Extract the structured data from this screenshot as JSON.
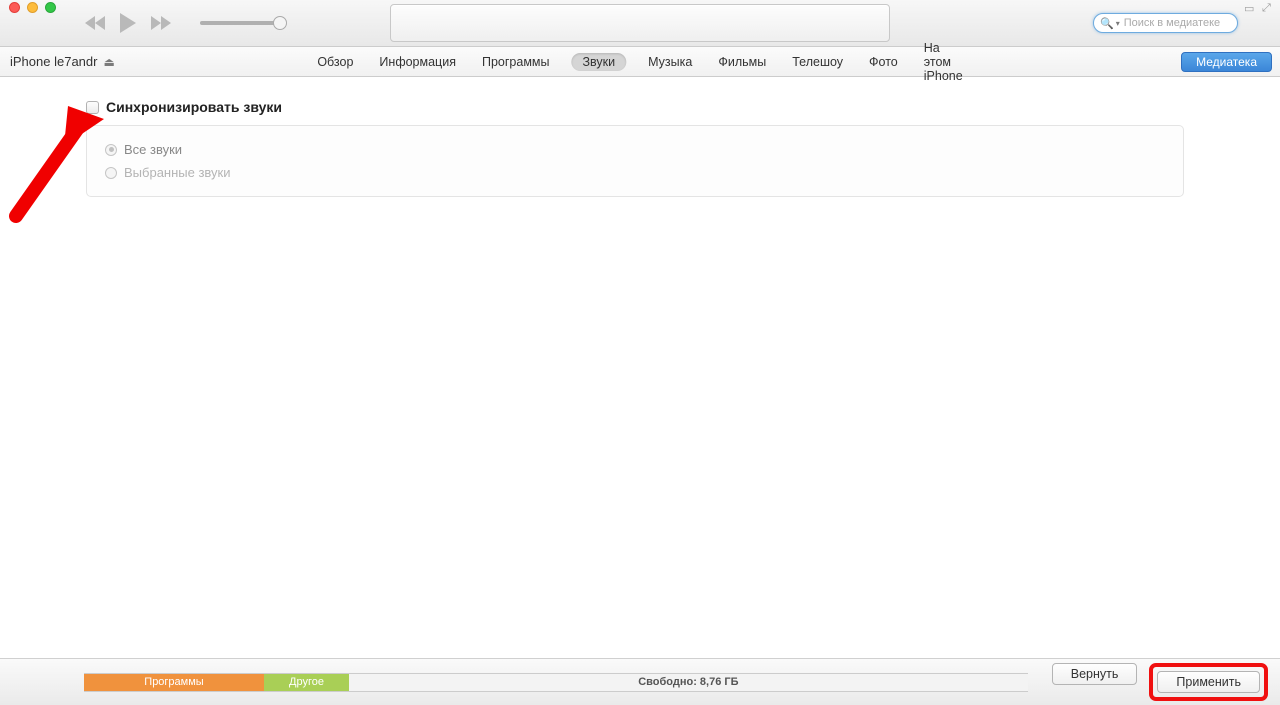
{
  "search": {
    "placeholder": "Поиск в медиатеке"
  },
  "device": {
    "name": "iPhone le7andr"
  },
  "tabs": {
    "items": [
      {
        "label": "Обзор"
      },
      {
        "label": "Информация"
      },
      {
        "label": "Программы"
      },
      {
        "label": "Звуки",
        "active": true
      },
      {
        "label": "Музыка"
      },
      {
        "label": "Фильмы"
      },
      {
        "label": "Телешоу"
      },
      {
        "label": "Фото"
      },
      {
        "label": "На этом iPhone"
      }
    ]
  },
  "library_button": "Медиатека",
  "sync": {
    "checkbox_label": "Синхронизировать звуки",
    "option_all": "Все звуки",
    "option_selected": "Выбранные звуки"
  },
  "capacity": {
    "apps_label": "Программы",
    "other_label": "Другое",
    "free_label": "Свободно: 8,76 ГБ"
  },
  "buttons": {
    "revert": "Вернуть",
    "apply": "Применить"
  }
}
